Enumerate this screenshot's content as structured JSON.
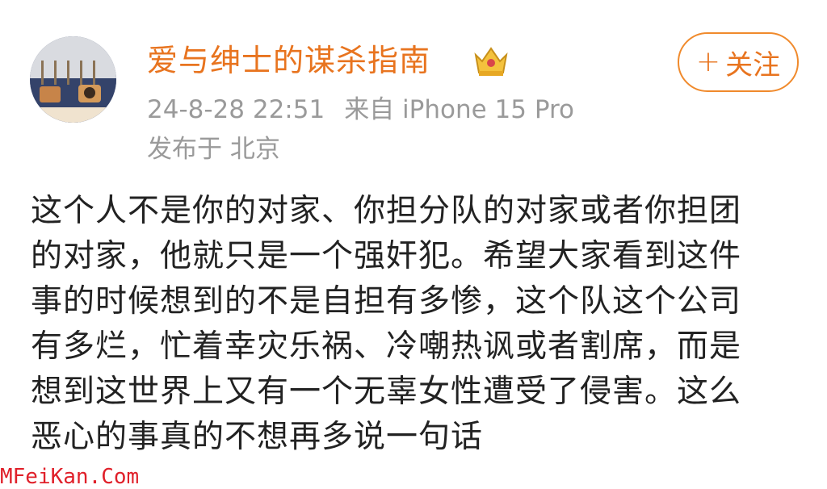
{
  "post": {
    "author": {
      "name": "爱与绅士的谋杀指南",
      "avatar_icon": "avatar-image",
      "badge_icon": "crown-badge-icon"
    },
    "follow_button": {
      "label": "关注",
      "icon": "plus-icon"
    },
    "meta": {
      "datetime": "24-8-28 22:51",
      "source": "来自 iPhone 15 Pro",
      "location": "发布于 北京"
    },
    "content_lines": [
      "这个人不是你的对家、你担分队的对家或者你担团",
      "的对家，他就只是一个强奸犯。希望大家看到这件",
      "事的时候想到的不是自担有多惨，这个队这个公司",
      "有多烂，忙着幸灾乐祸、冷嘲热讽或者割席，而是",
      "想到这世界上又有一个无辜女性遭受了侵害。这么",
      "恶心的事真的不想再多说一句话"
    ]
  },
  "watermark": "MFeiKan.Com",
  "colors": {
    "accent": "#e8741f",
    "meta_text": "#9a9a9a",
    "body_text": "#222222",
    "watermark": "#e0202a"
  }
}
